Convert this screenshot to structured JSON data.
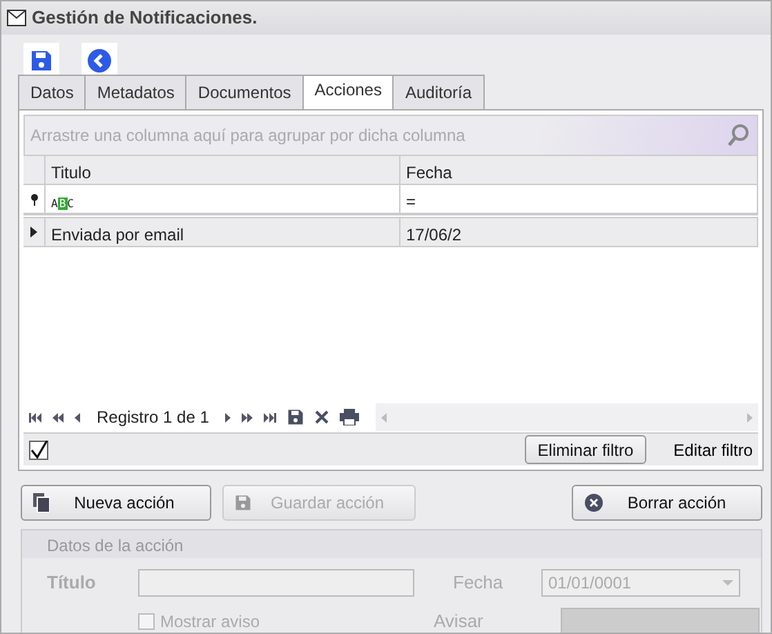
{
  "window": {
    "title": "Gestión de Notificaciones."
  },
  "tabs": [
    {
      "label": "Datos",
      "selected": false
    },
    {
      "label": "Metadatos",
      "selected": false
    },
    {
      "label": "Documentos",
      "selected": false
    },
    {
      "label": "Acciones",
      "selected": true
    },
    {
      "label": "Auditoría",
      "selected": false
    }
  ],
  "grid": {
    "group_hint": "Arrastre una columna aquí para agrupar por dicha columna",
    "columns": [
      "Titulo",
      "Fecha"
    ],
    "filter_row": [
      "ABC",
      "="
    ],
    "rows": [
      {
        "cells": [
          "Enviada por email",
          "17/06/2"
        ],
        "selected": true
      }
    ],
    "navigator": {
      "text": "Registro 1 de 1"
    },
    "filter_bar": {
      "enabled": true,
      "buttons": [
        "Eliminar filtro",
        "Editar filtro"
      ]
    }
  },
  "buttons": [
    {
      "label": "Nueva acción",
      "disabled": false
    },
    {
      "label": "Guardar acción",
      "disabled": true
    },
    {
      "label": "Borrar acción",
      "disabled": false
    }
  ],
  "details": {
    "title": "Datos de la acción",
    "disabled": true,
    "fields": [
      {
        "label": "Título"
      },
      {
        "label": "Fecha",
        "value": "01/01/0001"
      }
    ],
    "checkbox": {
      "label": "Mostrar aviso",
      "checked": false
    },
    "select": {
      "label": "Avisar"
    }
  }
}
